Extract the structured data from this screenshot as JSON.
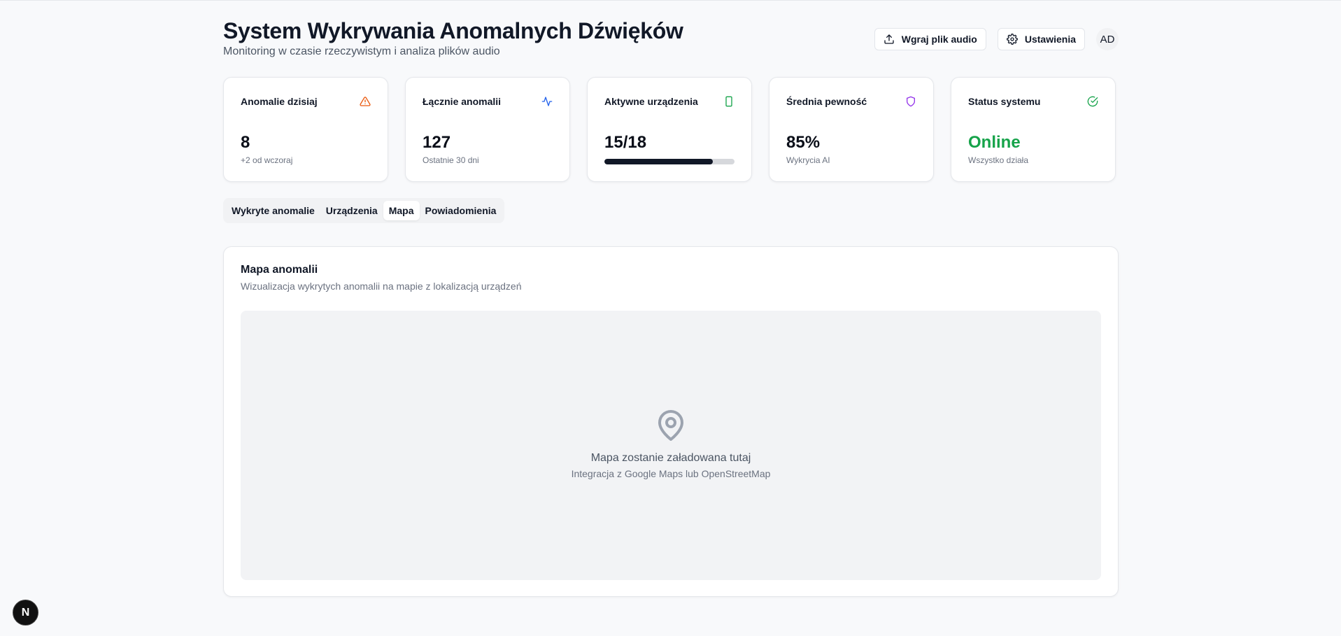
{
  "header": {
    "title": "System Wykrywania Anomalnych Dźwięków",
    "subtitle": "Monitoring w czasie rzeczywistym i analiza plików audio",
    "upload_label": "Wgraj plik audio",
    "settings_label": "Ustawienia",
    "avatar_initials": "AD"
  },
  "stats": [
    {
      "label": "Anomalie dzisiaj",
      "value": "8",
      "sub": "+2 od wczoraj",
      "icon": "alert-triangle-icon",
      "color": "#ea580c"
    },
    {
      "label": "Łącznie anomalii",
      "value": "127",
      "sub": "Ostatnie 30 dni",
      "icon": "activity-icon",
      "color": "#2563eb"
    },
    {
      "label": "Aktywne urządzenia",
      "value": "15/18",
      "progress": 0.8333,
      "icon": "smartphone-icon",
      "color": "#16a34a"
    },
    {
      "label": "Średnia pewność",
      "value": "85%",
      "sub": "Wykrycia AI",
      "icon": "shield-icon",
      "color": "#9333ea"
    },
    {
      "label": "Status systemu",
      "value": "Online",
      "sub": "Wszystko działa",
      "icon": "check-circle-icon",
      "color": "#16a34a"
    }
  ],
  "tabs": [
    {
      "label": "Wykryte anomalie",
      "active": false
    },
    {
      "label": "Urządzenia",
      "active": false
    },
    {
      "label": "Mapa",
      "active": true
    },
    {
      "label": "Powiadomienia",
      "active": false
    }
  ],
  "map_panel": {
    "title": "Mapa anomalii",
    "description": "Wizualizacja wykrytych anomalii na mapie z lokalizacją urządzeń",
    "placeholder_title": "Mapa zostanie załadowana tutaj",
    "placeholder_sub": "Integracja z Google Maps lub OpenStreetMap",
    "icon": "map-pin-icon"
  },
  "dev_badge": {
    "label": "N",
    "icon": "nextjs-icon"
  },
  "colors": {
    "accent_green": "#16a34a",
    "background": "#f8f9fb"
  }
}
